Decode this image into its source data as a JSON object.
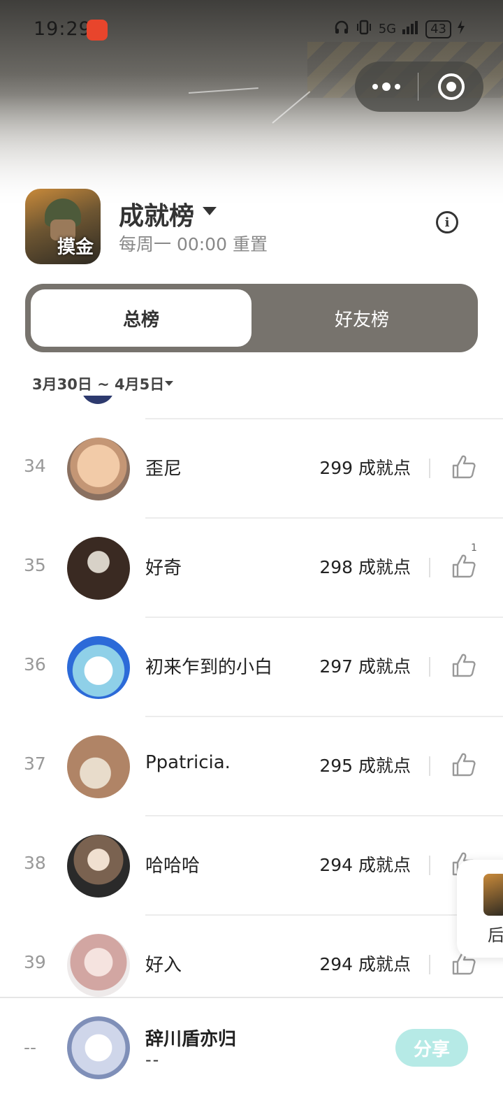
{
  "status_bar": {
    "time": "19:29",
    "network": "5G",
    "battery": "43"
  },
  "header": {
    "game_logo_text": "摸金",
    "title": "成就榜",
    "subtitle": "每周一 00:00 重置",
    "info_icon": "info-icon"
  },
  "tabs": [
    {
      "label": "总榜",
      "active": true
    },
    {
      "label": "好友榜",
      "active": false
    }
  ],
  "date_range": "3月30日 ~ 4月5日",
  "rows": [
    {
      "rank": "34",
      "name": "歪尼",
      "score": "299 成就点",
      "likes": ""
    },
    {
      "rank": "35",
      "name": "好奇",
      "score": "298 成就点",
      "likes": "1"
    },
    {
      "rank": "36",
      "name": "初来乍到的小白",
      "score": "297 成就点",
      "likes": ""
    },
    {
      "rank": "37",
      "name": "Ppatricia.",
      "score": "295 成就点",
      "likes": ""
    },
    {
      "rank": "38",
      "name": "哈哈哈",
      "score": "294 成就点",
      "likes": ""
    },
    {
      "rank": "39",
      "name": "好入",
      "score": "294 成就点",
      "likes": ""
    }
  ],
  "me": {
    "rank": "--",
    "name": "辞川盾亦归",
    "score": "--",
    "share_label": "分享"
  },
  "float_card": {
    "glyph": "后"
  },
  "colors": {
    "tab_track": "#77736d",
    "share_button": "#b6eae6"
  }
}
